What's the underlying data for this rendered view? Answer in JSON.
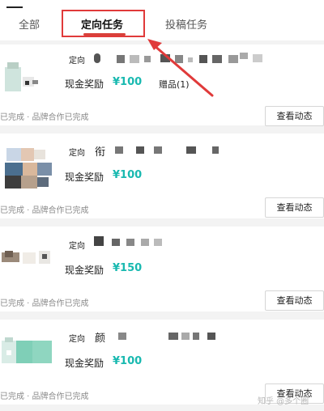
{
  "tabs": [
    {
      "label": "全部",
      "active": false
    },
    {
      "label": "定向任务",
      "active": true
    },
    {
      "label": "投稿任务",
      "active": false
    }
  ],
  "tasks": [
    {
      "kind": "定向",
      "name_char": "",
      "reward_label": "现金奖励",
      "reward_amount": "¥100",
      "gift": "赠品(1)",
      "status": "已完成 · 品牌合作已完成",
      "action": "查看动态"
    },
    {
      "kind": "定向",
      "name_char": "衔",
      "reward_label": "现金奖励",
      "reward_amount": "¥100",
      "gift": "",
      "status": "已完成 · 品牌合作已完成",
      "action": "查看动态"
    },
    {
      "kind": "定向",
      "name_char": "",
      "reward_label": "现金奖励",
      "reward_amount": "¥150",
      "gift": "",
      "status": "已完成 · 品牌合作已完成",
      "action": "查看动态"
    },
    {
      "kind": "定向",
      "name_char": "颜",
      "reward_label": "现金奖励",
      "reward_amount": "¥100",
      "gift": "",
      "status": "已完成 · 品牌合作已完成",
      "action": "查看动态"
    }
  ],
  "watermark": "知乎 @多个圈",
  "colors": {
    "accent": "#19b9b0",
    "annotation": "#e03a3a",
    "active_underline": "#d8413a"
  }
}
